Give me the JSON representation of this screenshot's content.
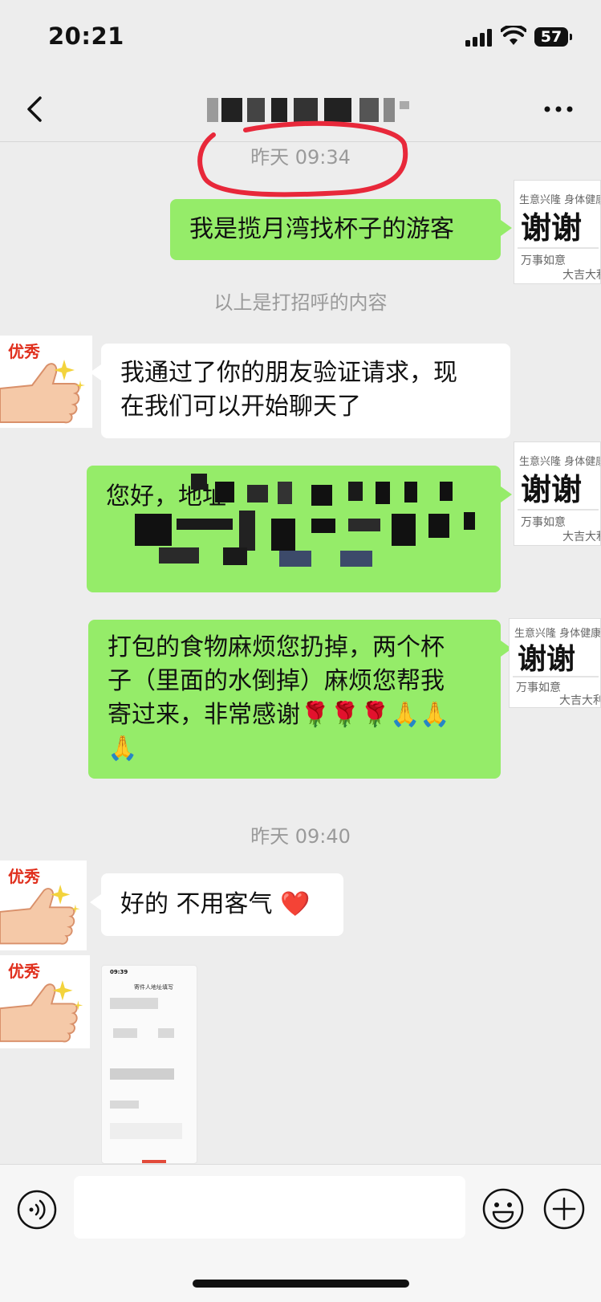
{
  "status_bar": {
    "time": "20:21",
    "battery": "57"
  },
  "header": {
    "back_icon": "chevron-left-icon",
    "more_icon": "more-dots-icon"
  },
  "chat": {
    "timestamp_1": "昨天 09:34",
    "timestamp_2": "昨天 09:40",
    "system_note": "以上是打招呼的内容",
    "messages": [
      {
        "side": "right",
        "text_lines": [
          "我是揽月湾找杯子的游客"
        ]
      },
      {
        "side": "left",
        "text_lines": [
          "我通过了你的朋友验证请求，现",
          "在我们可以开始聊天了"
        ]
      },
      {
        "side": "right",
        "text_lines": [
          "您好，地址"
        ]
      },
      {
        "side": "right",
        "text_lines": [
          "打包的食物麻烦您扔掉，两个杯",
          "子（里面的水倒掉）麻烦您帮我",
          "寄过来，非常感谢🌹🌹🌹🙏🙏",
          "🙏"
        ]
      },
      {
        "side": "left",
        "text_lines": [
          "好的 不用客气 ❤️"
        ]
      }
    ],
    "avatar_labels": {
      "thumb": "优秀",
      "thanks_top": "生意兴隆 身体健康",
      "thanks_main": "谢谢",
      "thanks_bottom_left": "万事如意",
      "thanks_bottom_right": "大吉大利"
    },
    "image_thumb": {
      "time": "09:39",
      "title": "寄件人地址填写"
    }
  },
  "input_bar": {
    "voice_icon": "voice-icon",
    "emoji_icon": "emoji-icon",
    "plus_icon": "plus-icon",
    "placeholder": ""
  },
  "colors": {
    "background": "#ededed",
    "sent_bubble": "#95ec69",
    "received_bubble": "#ffffff",
    "timestamp": "#9a9a9a",
    "highlight": "#e8283a"
  }
}
